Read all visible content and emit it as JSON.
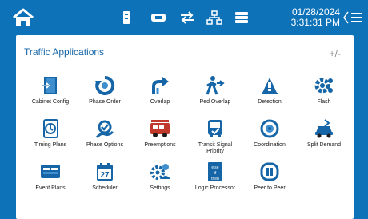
{
  "topbar": {
    "date": "01/28/2024",
    "time": "3:31:31 PM",
    "icons": [
      "home-icon",
      "cabinet-status-icon",
      "ethernet-icon",
      "swap-arrows-icon",
      "network-icon",
      "list-menu-icon",
      "chevron-left-icon",
      "hamburger-menu-icon"
    ]
  },
  "panel": {
    "title": "Traffic Applications",
    "zoom_label": "+/-",
    "apps": [
      {
        "label": "Cabinet Config",
        "icon": "cabinet-config-icon"
      },
      {
        "label": "Phase Order",
        "icon": "phase-order-icon"
      },
      {
        "label": "Overlap",
        "icon": "overlap-icon"
      },
      {
        "label": "Ped Overlap",
        "icon": "ped-overlap-icon"
      },
      {
        "label": "Detection",
        "icon": "detection-icon"
      },
      {
        "label": "Flash",
        "icon": "flash-icon"
      },
      {
        "label": "Timing Plans",
        "icon": "timing-plans-icon"
      },
      {
        "label": "Phase Options",
        "icon": "phase-options-icon"
      },
      {
        "label": "Preemptions",
        "icon": "preemptions-icon"
      },
      {
        "label": "Transit Signal",
        "label2": "Priority",
        "icon": "transit-signal-priority-icon"
      },
      {
        "label": "Coordination",
        "icon": "coordination-icon"
      },
      {
        "label": "Split Demand",
        "icon": "split-demand-icon"
      },
      {
        "label": "Event Plans",
        "icon": "event-plans-icon"
      },
      {
        "label": "Scheduler",
        "icon": "scheduler-icon",
        "badge": "27"
      },
      {
        "label": "Settings",
        "icon": "settings-icon"
      },
      {
        "label": "Logic Processor",
        "icon": "logic-processor-icon",
        "badge": "else if then"
      },
      {
        "label": "Peer to Peer",
        "icon": "peer-to-peer-icon"
      }
    ]
  },
  "colors": {
    "brand_blue": "#0e72b9",
    "icon_blue": "#1565a7",
    "icon_red": "#c0392b"
  }
}
